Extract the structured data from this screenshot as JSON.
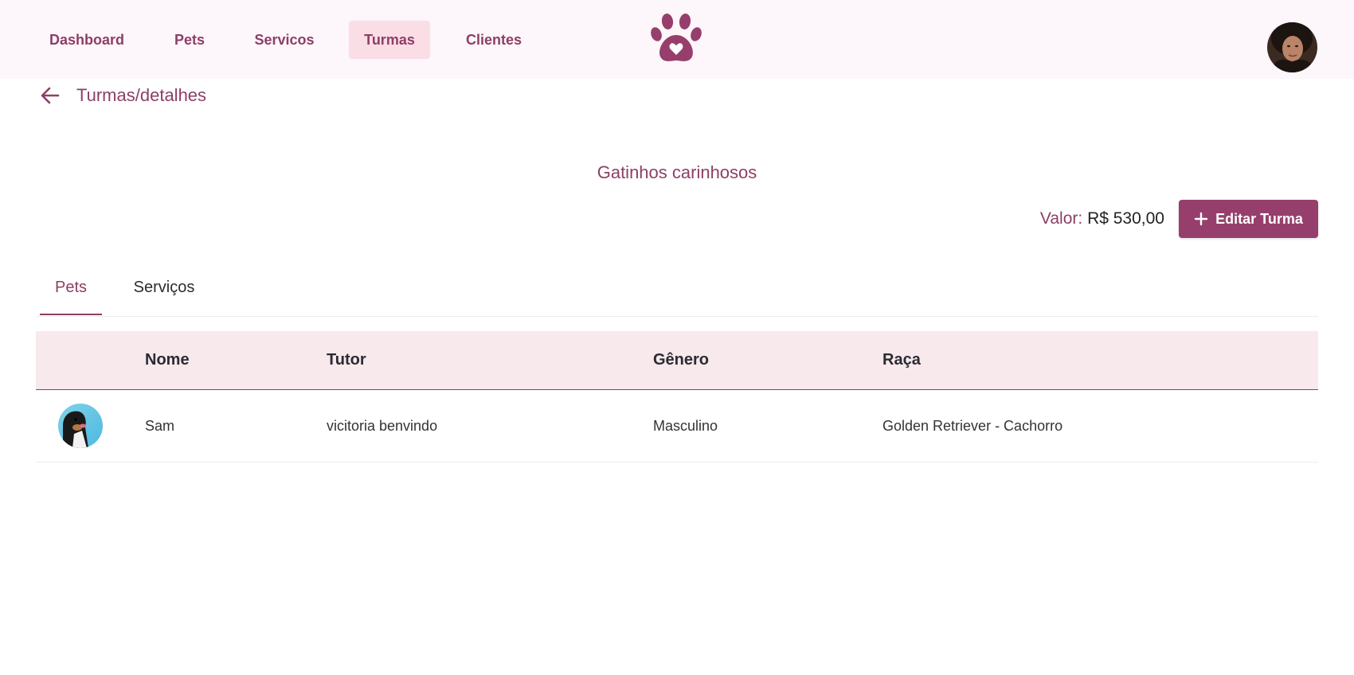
{
  "nav": {
    "items": [
      {
        "label": "Dashboard"
      },
      {
        "label": "Pets"
      },
      {
        "label": "Servicos"
      },
      {
        "label": "Turmas",
        "active": true
      },
      {
        "label": "Clientes"
      }
    ]
  },
  "header": {
    "logo_icon": "paw-heart-icon",
    "avatar_icon": "user-avatar"
  },
  "page": {
    "breadcrumb": "Turmas/detalhes",
    "back_icon": "arrow-left-icon",
    "class_name": "Gatinhos carinhosos",
    "price_label": "Valor:",
    "price_value": "R$ 530,00",
    "edit_button_label": "Editar Turma",
    "edit_button_icon": "plus-icon"
  },
  "tabs": [
    {
      "label": "Pets",
      "active": true
    },
    {
      "label": "Serviços",
      "active": false
    }
  ],
  "table": {
    "columns": [
      "",
      "Nome",
      "Tutor",
      "Gênero",
      "Raça"
    ],
    "rows": [
      {
        "photo": "dog-photo",
        "nome": "Sam",
        "tutor": "vicitoria benvindo",
        "genero": "Masculino",
        "raca": "Golden Retriever - Cachorro"
      }
    ]
  },
  "colors": {
    "accent": "#8d3f66",
    "button": "#973f6c",
    "active_nav_bg": "#fbdde6",
    "header_bg": "#fdf6fa",
    "table_header_bg": "#f7e9ec"
  }
}
